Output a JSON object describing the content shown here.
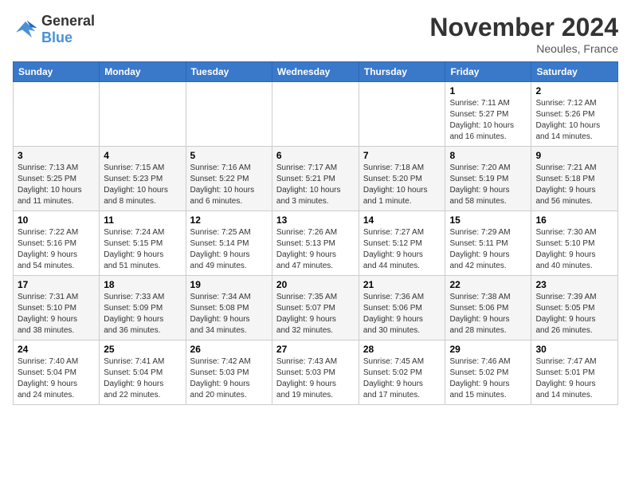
{
  "logo": {
    "line1": "General",
    "line2": "Blue"
  },
  "title": "November 2024",
  "location": "Neoules, France",
  "days_header": [
    "Sunday",
    "Monday",
    "Tuesday",
    "Wednesday",
    "Thursday",
    "Friday",
    "Saturday"
  ],
  "weeks": [
    [
      {
        "day": "",
        "info": ""
      },
      {
        "day": "",
        "info": ""
      },
      {
        "day": "",
        "info": ""
      },
      {
        "day": "",
        "info": ""
      },
      {
        "day": "",
        "info": ""
      },
      {
        "day": "1",
        "info": "Sunrise: 7:11 AM\nSunset: 5:27 PM\nDaylight: 10 hours\nand 16 minutes."
      },
      {
        "day": "2",
        "info": "Sunrise: 7:12 AM\nSunset: 5:26 PM\nDaylight: 10 hours\nand 14 minutes."
      }
    ],
    [
      {
        "day": "3",
        "info": "Sunrise: 7:13 AM\nSunset: 5:25 PM\nDaylight: 10 hours\nand 11 minutes."
      },
      {
        "day": "4",
        "info": "Sunrise: 7:15 AM\nSunset: 5:23 PM\nDaylight: 10 hours\nand 8 minutes."
      },
      {
        "day": "5",
        "info": "Sunrise: 7:16 AM\nSunset: 5:22 PM\nDaylight: 10 hours\nand 6 minutes."
      },
      {
        "day": "6",
        "info": "Sunrise: 7:17 AM\nSunset: 5:21 PM\nDaylight: 10 hours\nand 3 minutes."
      },
      {
        "day": "7",
        "info": "Sunrise: 7:18 AM\nSunset: 5:20 PM\nDaylight: 10 hours\nand 1 minute."
      },
      {
        "day": "8",
        "info": "Sunrise: 7:20 AM\nSunset: 5:19 PM\nDaylight: 9 hours\nand 58 minutes."
      },
      {
        "day": "9",
        "info": "Sunrise: 7:21 AM\nSunset: 5:18 PM\nDaylight: 9 hours\nand 56 minutes."
      }
    ],
    [
      {
        "day": "10",
        "info": "Sunrise: 7:22 AM\nSunset: 5:16 PM\nDaylight: 9 hours\nand 54 minutes."
      },
      {
        "day": "11",
        "info": "Sunrise: 7:24 AM\nSunset: 5:15 PM\nDaylight: 9 hours\nand 51 minutes."
      },
      {
        "day": "12",
        "info": "Sunrise: 7:25 AM\nSunset: 5:14 PM\nDaylight: 9 hours\nand 49 minutes."
      },
      {
        "day": "13",
        "info": "Sunrise: 7:26 AM\nSunset: 5:13 PM\nDaylight: 9 hours\nand 47 minutes."
      },
      {
        "day": "14",
        "info": "Sunrise: 7:27 AM\nSunset: 5:12 PM\nDaylight: 9 hours\nand 44 minutes."
      },
      {
        "day": "15",
        "info": "Sunrise: 7:29 AM\nSunset: 5:11 PM\nDaylight: 9 hours\nand 42 minutes."
      },
      {
        "day": "16",
        "info": "Sunrise: 7:30 AM\nSunset: 5:10 PM\nDaylight: 9 hours\nand 40 minutes."
      }
    ],
    [
      {
        "day": "17",
        "info": "Sunrise: 7:31 AM\nSunset: 5:10 PM\nDaylight: 9 hours\nand 38 minutes."
      },
      {
        "day": "18",
        "info": "Sunrise: 7:33 AM\nSunset: 5:09 PM\nDaylight: 9 hours\nand 36 minutes."
      },
      {
        "day": "19",
        "info": "Sunrise: 7:34 AM\nSunset: 5:08 PM\nDaylight: 9 hours\nand 34 minutes."
      },
      {
        "day": "20",
        "info": "Sunrise: 7:35 AM\nSunset: 5:07 PM\nDaylight: 9 hours\nand 32 minutes."
      },
      {
        "day": "21",
        "info": "Sunrise: 7:36 AM\nSunset: 5:06 PM\nDaylight: 9 hours\nand 30 minutes."
      },
      {
        "day": "22",
        "info": "Sunrise: 7:38 AM\nSunset: 5:06 PM\nDaylight: 9 hours\nand 28 minutes."
      },
      {
        "day": "23",
        "info": "Sunrise: 7:39 AM\nSunset: 5:05 PM\nDaylight: 9 hours\nand 26 minutes."
      }
    ],
    [
      {
        "day": "24",
        "info": "Sunrise: 7:40 AM\nSunset: 5:04 PM\nDaylight: 9 hours\nand 24 minutes."
      },
      {
        "day": "25",
        "info": "Sunrise: 7:41 AM\nSunset: 5:04 PM\nDaylight: 9 hours\nand 22 minutes."
      },
      {
        "day": "26",
        "info": "Sunrise: 7:42 AM\nSunset: 5:03 PM\nDaylight: 9 hours\nand 20 minutes."
      },
      {
        "day": "27",
        "info": "Sunrise: 7:43 AM\nSunset: 5:03 PM\nDaylight: 9 hours\nand 19 minutes."
      },
      {
        "day": "28",
        "info": "Sunrise: 7:45 AM\nSunset: 5:02 PM\nDaylight: 9 hours\nand 17 minutes."
      },
      {
        "day": "29",
        "info": "Sunrise: 7:46 AM\nSunset: 5:02 PM\nDaylight: 9 hours\nand 15 minutes."
      },
      {
        "day": "30",
        "info": "Sunrise: 7:47 AM\nSunset: 5:01 PM\nDaylight: 9 hours\nand 14 minutes."
      }
    ]
  ]
}
